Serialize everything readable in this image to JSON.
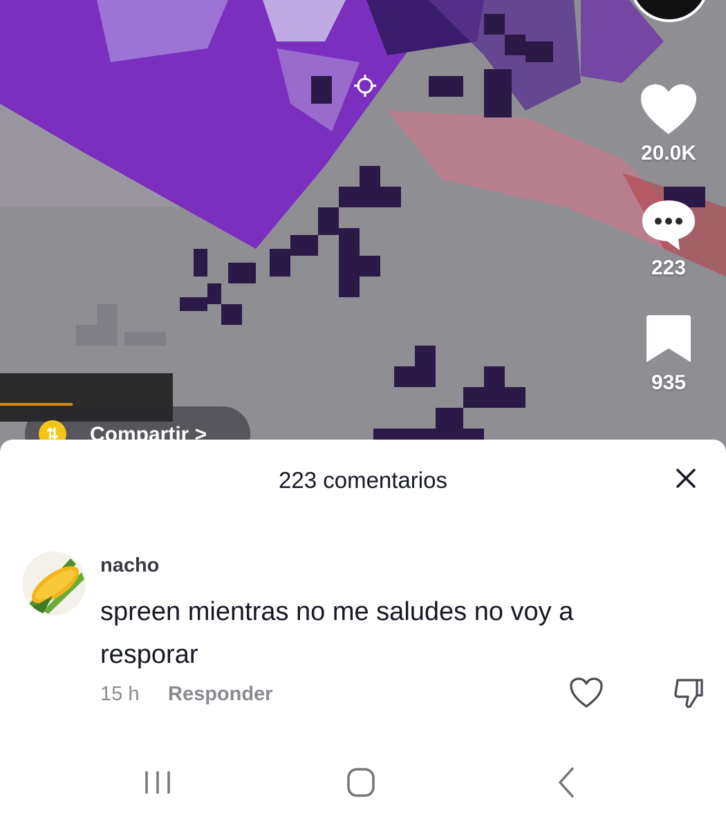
{
  "video": {
    "actions": {
      "likes": "20.0K",
      "comments": "223",
      "saves": "935"
    },
    "share_label": "Compartir >"
  },
  "comments_sheet": {
    "title": "223 comentarios",
    "comments": [
      {
        "username": "nacho",
        "text": "spreen mientras no me saludes no voy a resporar",
        "time": "15 h",
        "reply_label": "Responder"
      }
    ]
  },
  "icons": {
    "like": "heart-icon",
    "comment": "comment-bubble-icon",
    "save": "bookmark-icon",
    "close": "close-icon",
    "dislike": "thumbs-down-icon",
    "nav_recents": "recents-icon",
    "nav_home": "home-icon",
    "nav_back": "back-icon"
  },
  "colors": {
    "video_gray": "#8f8e93",
    "purple": "#7b2fbf",
    "share_yellow": "#f5c518",
    "text_primary": "#161823",
    "text_secondary": "#8a8b91"
  }
}
